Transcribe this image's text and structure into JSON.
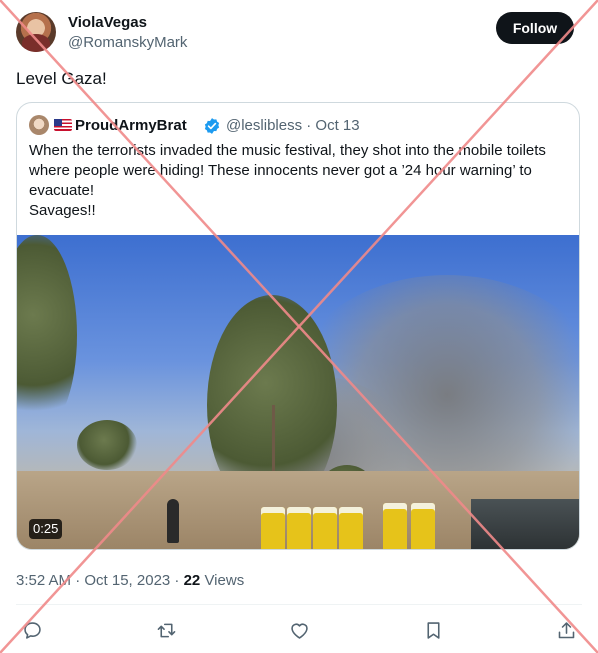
{
  "author": {
    "display_name": "ViolaVegas",
    "handle": "@RomanskyMark"
  },
  "follow_label": "Follow",
  "tweet_text": "Level Gaza!",
  "quoted": {
    "display_name": "ProudArmyBrat",
    "flag_icon": "us-flag-icon",
    "verified_icon": "verified-badge-icon",
    "meta": "@leslibless · Oct 13",
    "text_lines": [
      "When the terrorists invaded the music festival, they shot into the mobile toilets",
      "where people were hiding! These innocents never got a ’24 hour warning’ to",
      "evacuate!",
      "Savages!!"
    ],
    "media": {
      "duration": "0:25"
    }
  },
  "timestamp": {
    "time_date": "3:52 AM · Oct 15, 2023 · ",
    "views_count": "22",
    "views_label": " Views"
  },
  "action_icons": [
    "reply-icon",
    "retweet-icon",
    "like-icon",
    "bookmark-icon",
    "share-icon"
  ],
  "colors": {
    "text": "#0f1419",
    "secondary": "#536471",
    "verified": "#1d9bf0",
    "border": "#cfd9de",
    "watermark": "#f08a8a"
  }
}
